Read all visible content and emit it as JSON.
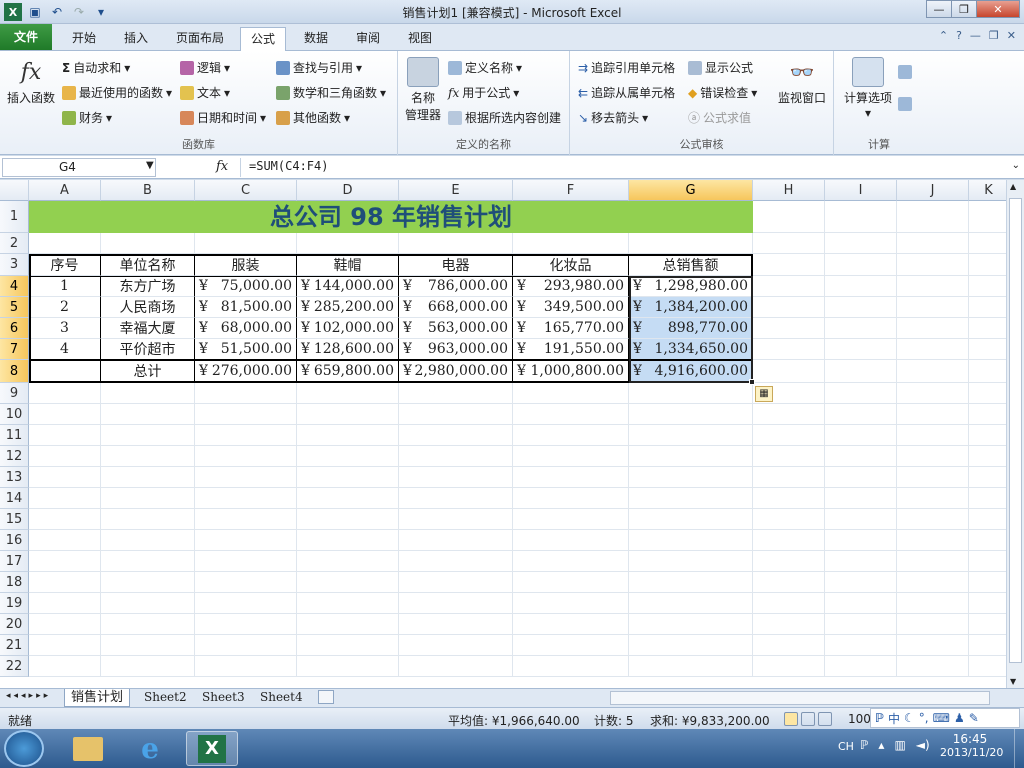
{
  "window": {
    "title": "销售计划1  [兼容模式] - Microsoft Excel"
  },
  "ribbon_tabs": [
    "文件",
    "开始",
    "插入",
    "页面布局",
    "公式",
    "数据",
    "审阅",
    "视图"
  ],
  "ribbon": {
    "function_library": {
      "insert_function": "插入函数",
      "autosum": "自动求和",
      "recent": "最近使用的函数",
      "finance": "财务",
      "logic": "逻辑",
      "text": "文本",
      "datetime": "日期和时间",
      "lookup": "查找与引用",
      "math": "数学和三角函数",
      "other": "其他函数",
      "label": "函数库"
    },
    "defined_names": {
      "name_manager": [
        "名称",
        "管理器"
      ],
      "define_name": "定义名称",
      "use_in_formula": "用于公式",
      "create_from_selection": "根据所选内容创建",
      "label": "定义的名称"
    },
    "auditing": {
      "trace_precedents": "追踪引用单元格",
      "trace_dependents": "追踪从属单元格",
      "remove_arrows": "移去箭头",
      "show_formulas": "显示公式",
      "error_checking": "错误检查",
      "evaluate_formula": "公式求值",
      "watch_window": "监视窗口",
      "label": "公式审核"
    },
    "calculation": {
      "calc_options": "计算选项",
      "label": "计算"
    }
  },
  "formula_bar": {
    "name_box": "G4",
    "fx": "fx",
    "formula": "=SUM(C4:F4)"
  },
  "columns": [
    "A",
    "B",
    "C",
    "D",
    "E",
    "F",
    "G",
    "H",
    "I",
    "J",
    "K"
  ],
  "rows": [
    "1",
    "2",
    "3",
    "4",
    "5",
    "6",
    "7",
    "8",
    "9",
    "10",
    "11",
    "12",
    "13",
    "14",
    "15",
    "16",
    "17",
    "18",
    "19",
    "20",
    "21",
    "22"
  ],
  "sheet": {
    "title": "总公司  98  年销售计划",
    "currency": "¥",
    "headers": [
      "序号",
      "单位名称",
      "服装",
      "鞋帽",
      "电器",
      "化妆品",
      "总销售额"
    ],
    "rows": [
      {
        "no": "1",
        "name": "东方广场",
        "values": [
          "75,000.00",
          "144,000.00",
          "786,000.00",
          "293,980.00",
          "1,298,980.00"
        ]
      },
      {
        "no": "2",
        "name": "人民商场",
        "values": [
          "81,500.00",
          "285,200.00",
          "668,000.00",
          "349,500.00",
          "1,384,200.00"
        ]
      },
      {
        "no": "3",
        "name": "幸福大厦",
        "values": [
          "68,000.00",
          "102,000.00",
          "563,000.00",
          "165,770.00",
          "898,770.00"
        ]
      },
      {
        "no": "4",
        "name": "平价超市",
        "values": [
          "51,500.00",
          "128,600.00",
          "963,000.00",
          "191,550.00",
          "1,334,650.00"
        ]
      }
    ],
    "total": {
      "label": "总计",
      "values": [
        "276,000.00",
        "659,800.00",
        "2,980,000.00",
        "1,000,800.00",
        "4,916,600.00"
      ]
    }
  },
  "sheet_tabs": [
    "销售计划",
    "Sheet2",
    "Sheet3",
    "Sheet4"
  ],
  "status": {
    "mode": "就绪",
    "average": "平均值: ¥1,966,640.00",
    "count": "计数: 5",
    "sum": "求和: ¥9,833,200.00",
    "zoom": "100"
  },
  "ime": {
    "lang": "中"
  },
  "taskbar": {
    "lang": "CH",
    "time": "16:45",
    "date": "2013/11/20"
  }
}
